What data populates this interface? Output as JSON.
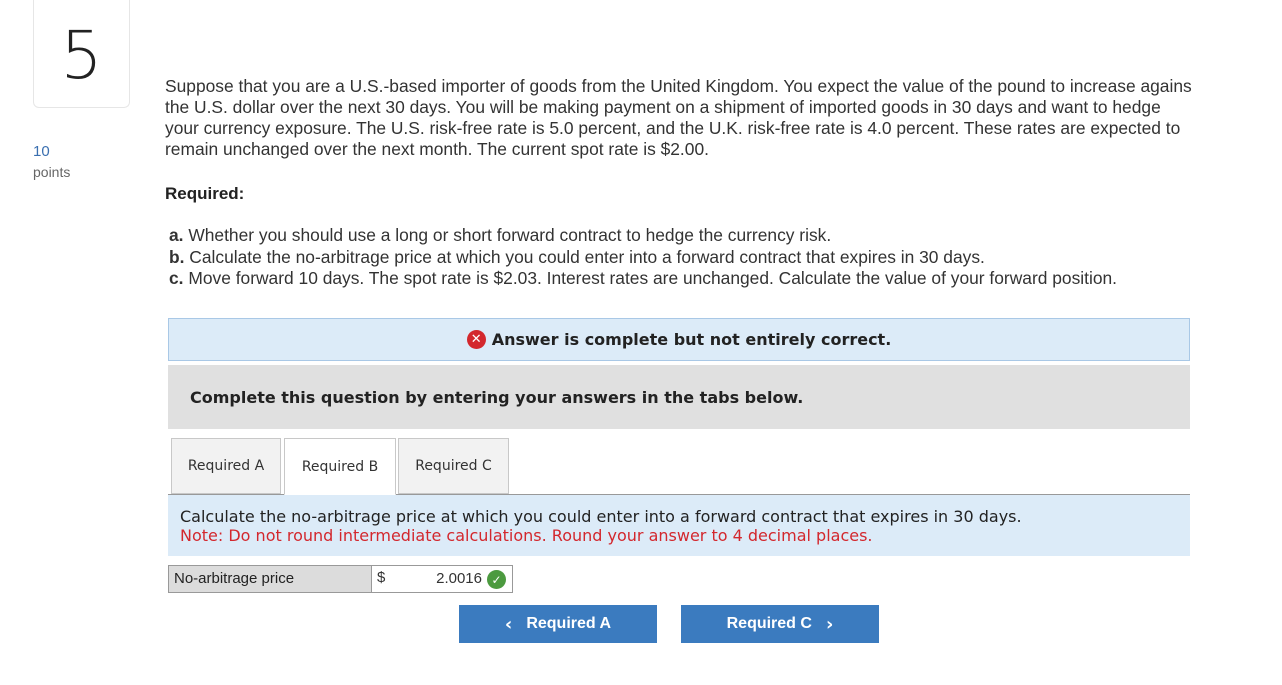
{
  "question": {
    "number": "5",
    "points_value": "10",
    "points_label": "points",
    "text_lines": [
      "Suppose that you are a U.S.-based importer of goods from the United Kingdom. You expect the value of the pound to increase agains",
      "the U.S. dollar over the next 30 days. You will be making payment on a shipment of imported goods in 30 days and want to hedge",
      "your currency exposure. The U.S. risk-free rate is 5.0 percent, and the U.K. risk-free rate is 4.0 percent. These rates are expected to",
      "remain unchanged over the next month. The current spot rate is $2.00."
    ],
    "required_heading": "Required:",
    "requirements": [
      {
        "letter": "a.",
        "text": " Whether you should use a long or short forward contract to hedge the currency risk."
      },
      {
        "letter": "b.",
        "text": " Calculate the no-arbitrage price at which you could enter into a forward contract that expires in 30 days."
      },
      {
        "letter": "c.",
        "text": " Move forward 10 days. The spot rate is $2.03. Interest rates are unchanged. Calculate the value of your forward position."
      }
    ]
  },
  "feedback": {
    "icon": "x-circle-icon",
    "text": "Answer is complete but not entirely correct."
  },
  "instructions": "Complete this question by entering your answers in the tabs below.",
  "tabs": [
    {
      "label": "Required A",
      "active": false
    },
    {
      "label": "Required B",
      "active": true
    },
    {
      "label": "Required C",
      "active": false
    }
  ],
  "panel": {
    "main": "Calculate the no-arbitrage price at which you could enter into a forward contract that expires in 30 days.",
    "note": "Note: Do not round intermediate calculations. Round your answer to 4 decimal places."
  },
  "answer": {
    "label": "No-arbitrage price",
    "currency": "$",
    "value": "2.0016",
    "status_icon": "check-circle-icon"
  },
  "nav": {
    "prev_label": "Required A",
    "prev_chevron": "‹",
    "next_label": "Required C",
    "next_chevron": "›"
  },
  "colors": {
    "feedback_bg": "#dcebf8",
    "error_red": "#d3272d",
    "check_green": "#4c9a3f",
    "button_blue": "#3b7bbf",
    "instruction_bg": "#e0e0e0"
  }
}
